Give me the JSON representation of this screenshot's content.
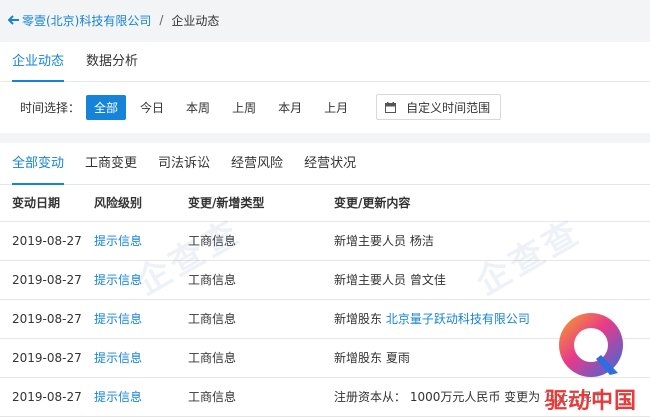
{
  "breadcrumb": {
    "company": "零壹(北京)科技有限公司",
    "separator": "/",
    "current": "企业动态"
  },
  "top_tabs": [
    {
      "label": "企业动态",
      "active": true
    },
    {
      "label": "数据分析",
      "active": false
    }
  ],
  "filter": {
    "label": "时间选择：",
    "options": [
      "全部",
      "今日",
      "本周",
      "上周",
      "本月",
      "上月"
    ],
    "selected": "全部",
    "custom_range": "自定义时间范围"
  },
  "change_tabs": [
    "全部变动",
    "工商变更",
    "司法诉讼",
    "经营风险",
    "经营状况"
  ],
  "table": {
    "headers": [
      "变动日期",
      "风险级别",
      "变更/新增类型",
      "变更/更新内容"
    ],
    "rows": [
      {
        "date": "2019-08-27",
        "risk": "提示信息",
        "type": "工商信息",
        "content": "新增主要人员  杨洁",
        "link": ""
      },
      {
        "date": "2019-08-27",
        "risk": "提示信息",
        "type": "工商信息",
        "content": "新增主要人员  曾文佳",
        "link": ""
      },
      {
        "date": "2019-08-27",
        "risk": "提示信息",
        "type": "工商信息",
        "content": "新增股东 ",
        "link": "北京量子跃动科技有限公司"
      },
      {
        "date": "2019-08-27",
        "risk": "提示信息",
        "type": "工商信息",
        "content": "新增股东  夏雨",
        "link": ""
      },
      {
        "date": "2019-08-27",
        "risk": "提示信息",
        "type": "工商信息",
        "content": "注册资本从： 1000万元人民币 变更为 万元人民币",
        "link": ""
      }
    ]
  },
  "watermark": "企查查",
  "logo_text": "驱动中国",
  "colors": {
    "accent": "#1583d9",
    "brand_red": "#e83a3a"
  }
}
